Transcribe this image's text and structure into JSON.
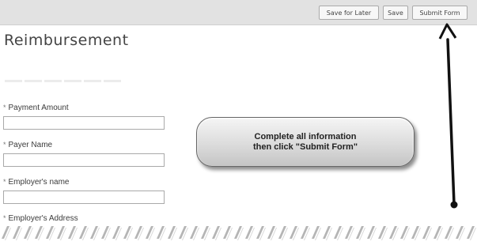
{
  "toolbar": {
    "save_for_later_label": "Save for Later",
    "save_label": "Save",
    "submit_label": "Submit Form"
  },
  "page": {
    "title": "Reimbursement"
  },
  "form": {
    "required_marker": "*",
    "fields": [
      {
        "label": "Payment Amount",
        "value": ""
      },
      {
        "label": "Payer Name",
        "value": ""
      },
      {
        "label": "Employer's name",
        "value": ""
      },
      {
        "label": "Employer's Address",
        "value": ""
      }
    ]
  },
  "callout": {
    "line1": "Complete all information",
    "line2": "then click \"Submit Form\""
  },
  "colors": {
    "toolbar_bg": "#e2e2e2",
    "arrow": "#111111"
  }
}
